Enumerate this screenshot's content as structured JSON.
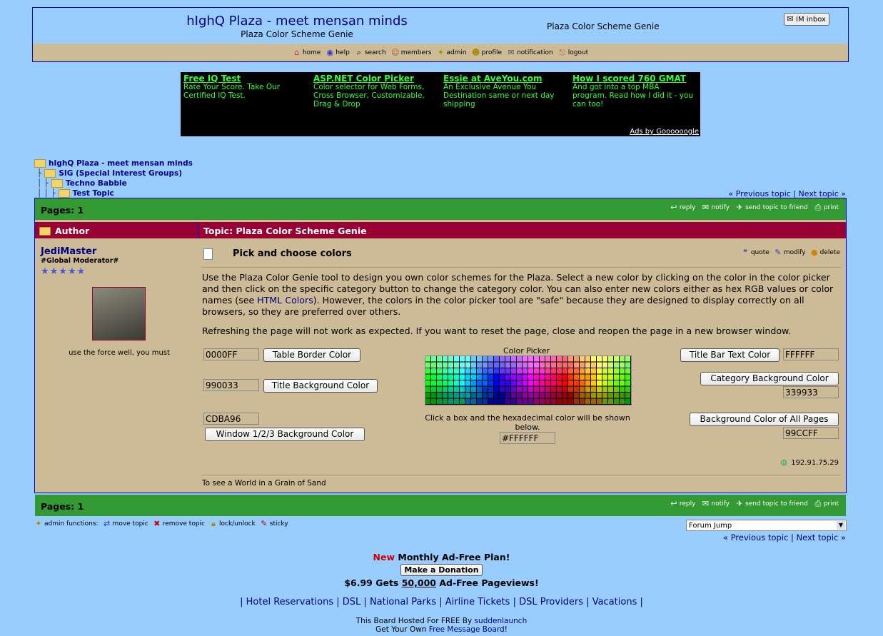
{
  "header": {
    "title": "hIghQ Plaza - meet mensan minds",
    "subtitle": "Plaza Color Scheme Genie",
    "right_text": "Plaza Color Scheme Genie",
    "inbox_label": "IM inbox"
  },
  "menu": [
    {
      "label": "home",
      "icon": "home-icon"
    },
    {
      "label": "help",
      "icon": "help-icon"
    },
    {
      "label": "search",
      "icon": "search-icon"
    },
    {
      "label": "members",
      "icon": "members-icon"
    },
    {
      "label": "admin",
      "icon": "admin-icon"
    },
    {
      "label": "profile",
      "icon": "profile-icon"
    },
    {
      "label": "notification",
      "icon": "notification-icon"
    },
    {
      "label": "logout",
      "icon": "logout-icon"
    }
  ],
  "ads": {
    "items": [
      {
        "title": "Free IQ Test",
        "text": "Rate Your Score. Take Our Certified IQ Test."
      },
      {
        "title": "ASP.NET Color Picker",
        "text": "Color selector for Web Forms, Cross Browser, Customizable, Drag & Drop"
      },
      {
        "title": "Essie at AveYou.com",
        "text": "An Exclusive Avenue You Destination same or next day shipping"
      },
      {
        "title": "How I scored 760 GMAT",
        "text": "And got into a top MBA program. Read how I did it - you can too!"
      }
    ],
    "ads_by": "Ads by Goooooogle"
  },
  "breadcrumb": [
    "hIghQ Plaza - meet mensan minds",
    "SIG (Special Interest Groups)",
    "Techno Babble",
    "Test Topic"
  ],
  "topic_nav": {
    "prev": "« Previous topic",
    "sep": "|",
    "next": "Next topic »"
  },
  "pages_label": "Pages: 1",
  "bar_actions": [
    "reply",
    "notify",
    "send topic to friend",
    "print"
  ],
  "columns": {
    "author": "Author",
    "topic": "Topic: Plaza Color Scheme Genie"
  },
  "user": {
    "name": "JediMaster",
    "rank": "#Global Moderator#",
    "stars": "★★★★★",
    "signature_line": "use the force well, you must"
  },
  "post": {
    "title": "Pick and choose colors",
    "actions": [
      "quote",
      "modify",
      "delete"
    ],
    "para1_a": "Use the Plaza Color Genie tool to design you own color schemes for the Plaza. Select a new color by clicking on the color in the color picker and then click on the specific category button to change the category color. You can also enter new colors either as hex RGB values or color names (see ",
    "para1_link": "HTML Colors",
    "para1_b": "). However, the colors in the color picker tool are \"safe\" because they are designed to display correctly on all browsers, so they are preferred over others.",
    "para2": "Refreshing the page will not work as expected. If you want to reset the page, close and reopen the page in a new browser window.",
    "ip": "192.91.75.29",
    "signature": "To see a World in a Grain of Sand"
  },
  "genie": {
    "table_border": {
      "value": "0000FF",
      "button": "Table Border Color"
    },
    "title_bg": {
      "value": "990033",
      "button": "Title Background Color"
    },
    "window_bg": {
      "value": "CDBA96",
      "button": "Window 1/2/3 Background Color"
    },
    "title_text": {
      "value": "FFFFFF",
      "button": "Title Bar Text Color"
    },
    "category_bg": {
      "value": "339933",
      "button": "Category Background Color"
    },
    "page_bg": {
      "value": "99CCFF",
      "button": "Background Color of All Pages"
    },
    "picker_label": "Color Picker",
    "picker_caption": "Click a box and the hexadecimal color will be shown below.",
    "picked_value": "#FFFFFF"
  },
  "admin": {
    "label": "admin functions:",
    "actions": [
      "move topic",
      "remove topic",
      "lock/unlock",
      "sticky"
    ]
  },
  "forum_jump": "Forum Jump",
  "footer": {
    "new": "New",
    "plan": "Monthly Ad-Free Plan!",
    "donate": "Make a Donation",
    "price_a": "$6.99 Gets ",
    "price_num": "50,000",
    "price_b": " Ad-Free Pageviews!",
    "links": [
      "Hotel Reservations",
      "DSL",
      "National Parks",
      "Airline Tickets",
      "DSL Providers",
      "Vacations"
    ],
    "hosted_a": "This Board Hosted For FREE By ",
    "hosted_link": "suddenlaunch",
    "own_a": "Get Your Own ",
    "own_link": "Free Message Board",
    "own_b": "!"
  },
  "colors": {
    "page_bg": "#99CCFF",
    "window_bg": "#CDBA96",
    "title_bg": "#990033",
    "category_bg": "#339933",
    "table_border": "#0000FF"
  }
}
